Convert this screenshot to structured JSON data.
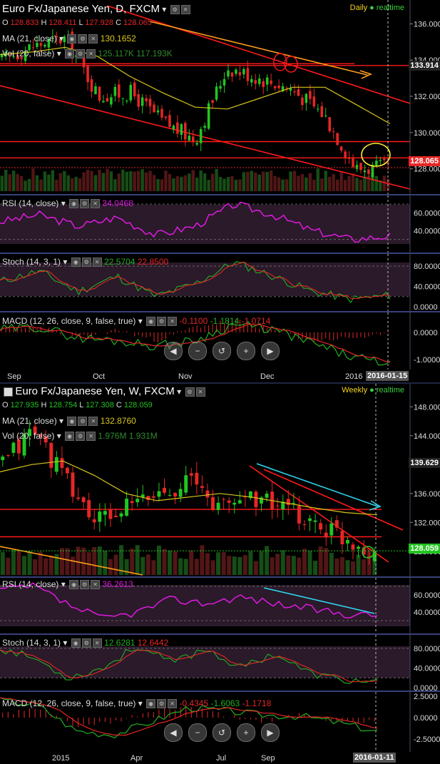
{
  "daily": {
    "title": "Euro Fx/Japanese Yen, D, FXCM",
    "period": "Daily",
    "realtime": "realtime",
    "ohlc": {
      "O_label": "O",
      "O": "128.833",
      "H_label": "H",
      "H": "128.411",
      "L_label": "L",
      "L": "127.928",
      "C_label": "C",
      "C": "128.065"
    },
    "ma_label": "MA (21, close)",
    "ma_value": "130.1652",
    "vol_label": "Vol (20, false)",
    "vol_values": "125.117K 117.193K",
    "rsi_label": "RSI (14, close)",
    "rsi_value": "34.0468",
    "stoch_label": "Stoch (14, 3, 1)",
    "stoch_k": "22.5704",
    "stoch_d": "22.8500",
    "macd_label": "MACD (12, 26, close, 9, false, true)",
    "macd_hist": "-0.1100",
    "macd_line": "-1.1814",
    "macd_signal": "-1.0714",
    "price_ticks": [
      "136.000",
      "134.000",
      "132.000",
      "130.000",
      "128.000"
    ],
    "last_price": "128.065",
    "level_price": "133.914",
    "rsi_ticks": [
      "60.0000",
      "40.0000"
    ],
    "stoch_ticks": [
      "80.0000",
      "40.0000",
      "0.0000"
    ],
    "macd_ticks": [
      "0.0000",
      "-1.0000"
    ],
    "x_labels": [
      "Sep",
      "Oct",
      "Nov",
      "Dec",
      "2016"
    ],
    "cursor_date": "2016-01-15"
  },
  "weekly": {
    "title": "Euro Fx/Japanese Yen, W, FXCM",
    "period": "Weekly",
    "realtime": "realtime",
    "ohlc": {
      "O_label": "O",
      "O": "127.935",
      "H_label": "H",
      "H": "128.754",
      "L_label": "L",
      "L": "127.308",
      "C_label": "C",
      "C": "128.059"
    },
    "ma_label": "MA (21, close)",
    "ma_value": "132.8760",
    "vol_label": "Vol (20, false)",
    "vol_values": "1.976M 1.931M",
    "rsi_label": "RSI (14, close)",
    "rsi_value": "36.2613",
    "stoch_label": "Stoch (14, 3, 1)",
    "stoch_k": "12.6281",
    "stoch_d": "12.6442",
    "macd_label": "MACD (12, 26, close, 9, false, true)",
    "macd_hist": "-0.4345",
    "macd_line": "-1.6063",
    "macd_signal": "-1.1718",
    "price_ticks": [
      "148.000",
      "144.000",
      "140.000",
      "136.000",
      "132.000",
      "128.000"
    ],
    "last_price": "128.059",
    "level_price": "139.629",
    "rsi_ticks": [
      "60.0000",
      "40.0000"
    ],
    "stoch_ticks": [
      "80.0000",
      "40.0000",
      "0.0000"
    ],
    "macd_ticks": [
      "2.5000",
      "0.0000",
      "-2.5000"
    ],
    "x_labels": [
      "2015",
      "Apr",
      "Jul",
      "Sep"
    ],
    "cursor_date": "2016-01-11"
  },
  "nav_buttons": [
    "◀",
    "−",
    "↺",
    "+",
    "▶"
  ],
  "colors": {
    "up": "#21c521",
    "down": "#e62626",
    "ma": "#d8c61a",
    "rsi": "#e01ae0",
    "stoch_k": "#22b022",
    "stoch_d": "#e62626",
    "trend": "#ff1a1a",
    "orange": "#ff9d1a",
    "cyan": "#2ed6f0",
    "yellow": "#ffee33"
  },
  "chart_data": [
    {
      "type": "line",
      "title": "Euro Fx/Japanese Yen, D, FXCM",
      "x": [
        "Sep",
        "Oct",
        "Nov",
        "Dec",
        "2016"
      ],
      "series": [
        {
          "name": "Close",
          "values": [
            134.0,
            134.8,
            135.2,
            132.0,
            132.2,
            130.6,
            129.6,
            133.6,
            133.0,
            132.4,
            131.0,
            128.0,
            128.065
          ]
        },
        {
          "name": "MA (21, close)",
          "values": [
            134.3,
            134.6,
            134.8,
            133.6,
            132.6,
            131.8,
            131.0,
            131.6,
            132.2,
            132.8,
            132.2,
            130.8,
            130.1652
          ]
        }
      ],
      "ylim": [
        127.0,
        137.0
      ]
    },
    {
      "type": "line",
      "title": "Euro Fx/Japanese Yen, W, FXCM",
      "x": [
        "2015",
        "Apr",
        "Jul",
        "Sep"
      ],
      "series": [
        {
          "name": "Close",
          "values": [
            140.0,
            145.0,
            138.0,
            132.0,
            134.0,
            136.0,
            138.0,
            134.0,
            136.0,
            134.0,
            132.0,
            130.0,
            128.059
          ]
        },
        {
          "name": "MA (21, close)",
          "values": [
            139.0,
            141.0,
            140.0,
            137.0,
            135.0,
            135.0,
            136.0,
            136.0,
            135.0,
            134.5,
            133.5,
            133.2,
            132.876
          ]
        }
      ],
      "ylim": [
        126.0,
        150.0
      ]
    }
  ]
}
